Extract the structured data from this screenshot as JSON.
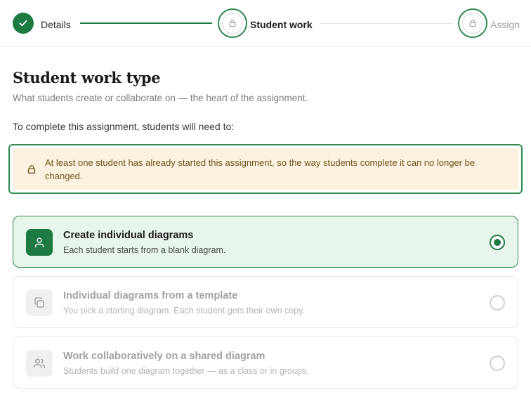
{
  "stepper": {
    "steps": [
      {
        "label": "Details",
        "state": "complete",
        "icon": "check-icon"
      },
      {
        "label": "Student work",
        "state": "current",
        "icon": "lock-icon"
      },
      {
        "label": "Assign",
        "state": "upcoming",
        "icon": "lock-icon"
      }
    ]
  },
  "header": {
    "title": "Student work type",
    "subtitle": "What students create or collaborate on — the heart of the assignment."
  },
  "instruction": "To complete this assignment, students will need to:",
  "notice": {
    "icon": "lock-icon",
    "text": "At least one student has already started this assignment, so the way students complete it can no longer be changed."
  },
  "options": [
    {
      "title": "Create individual diagrams",
      "description": "Each student starts from a blank diagram.",
      "icon": "person-icon",
      "selected": true
    },
    {
      "title": "Individual diagrams from a template",
      "description": "You pick a starting diagram. Each student gets their own copy.",
      "icon": "copy-icon",
      "selected": false
    },
    {
      "title": "Work collaboratively on a shared diagram",
      "description": "Students build one diagram together — as a class or in groups.",
      "icon": "people-icon",
      "selected": false
    }
  ],
  "colors": {
    "accent": "#1e7a43",
    "accent_border": "#2f8a4f",
    "selected_bg": "#e7f5ea",
    "notice_bg": "#fdf1e0",
    "notice_text": "#6a5419"
  }
}
